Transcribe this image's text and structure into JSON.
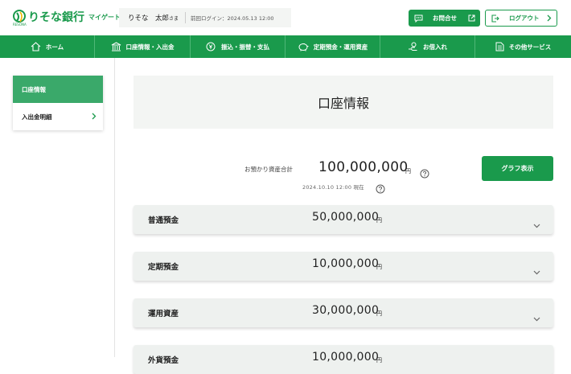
{
  "header": {
    "logo": "りそな銀行",
    "logo_sub": "マイゲート",
    "logo_small": "RESONA",
    "user_name": "りそな　太郎",
    "user_honorific": "さま",
    "last_login": "前回ログイン：2024.05.13 12:00",
    "contact_label": "お問合せ",
    "logout_label": "ログアウト"
  },
  "nav": {
    "items": [
      {
        "label": "ホーム",
        "icon": "home-icon"
      },
      {
        "label": "口座情報・入出金",
        "icon": "bank-icon"
      },
      {
        "label": "振込・振替・支払",
        "icon": "yen-coin-icon"
      },
      {
        "label": "定期預金・運用資産",
        "icon": "piggy-bank-icon"
      },
      {
        "label": "お借入れ",
        "icon": "hand-coin-icon"
      },
      {
        "label": "その他サービス",
        "icon": "document-icon"
      }
    ]
  },
  "sidebar": {
    "items": [
      {
        "label": "口座情報",
        "active": true
      },
      {
        "label": "入出金明細",
        "active": false
      }
    ]
  },
  "main": {
    "title": "口座情報",
    "total_label": "お預かり資産合計",
    "total_value": "100,000,000",
    "unit": "円",
    "timestamp": "2024.10.10 12:00 現在",
    "graph_button": "グラフ表示",
    "accounts": [
      {
        "name": "普通預金",
        "amount": "50,000,000",
        "unit": "円"
      },
      {
        "name": "定期預金",
        "amount": "10,000,000",
        "unit": "円"
      },
      {
        "name": "運用資産",
        "amount": "30,000,000",
        "unit": "円"
      },
      {
        "name": "外貨預金",
        "amount": "10,000,000",
        "unit": "円"
      }
    ]
  },
  "colors": {
    "brand_green": "#1a9a4c",
    "active_green": "#3aa96a",
    "panel_gray": "#f3f5f3"
  }
}
